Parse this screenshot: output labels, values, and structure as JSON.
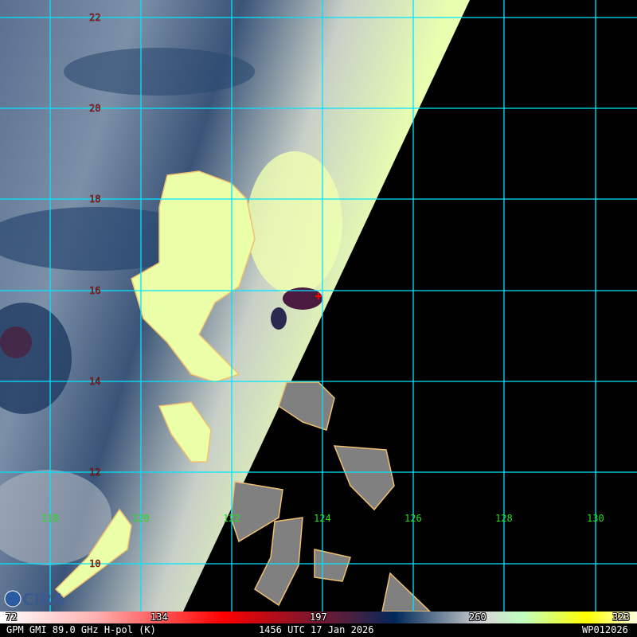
{
  "map": {
    "lat_labels": [
      "22",
      "20",
      "18",
      "16",
      "14",
      "12",
      "10"
    ],
    "lon_labels": [
      "118",
      "120",
      "122",
      "124",
      "126",
      "128",
      "130"
    ],
    "logo": "CIRA",
    "colors": {
      "grid": "#00e5ff",
      "land_outline": "#f0c070",
      "lat_label": "#ff2020",
      "lon_label": "#20e020",
      "no_data": "#000000",
      "storm_marker": "#ff0000"
    }
  },
  "colorbar": {
    "ticks": [
      "72",
      "134",
      "197",
      "260",
      "323"
    ],
    "units": "K"
  },
  "footer": {
    "product": "GPM GMI 89.0 GHz H-pol (K)",
    "time": "1456 UTC 17 Jan 2026",
    "storm_id": "WP012026"
  }
}
